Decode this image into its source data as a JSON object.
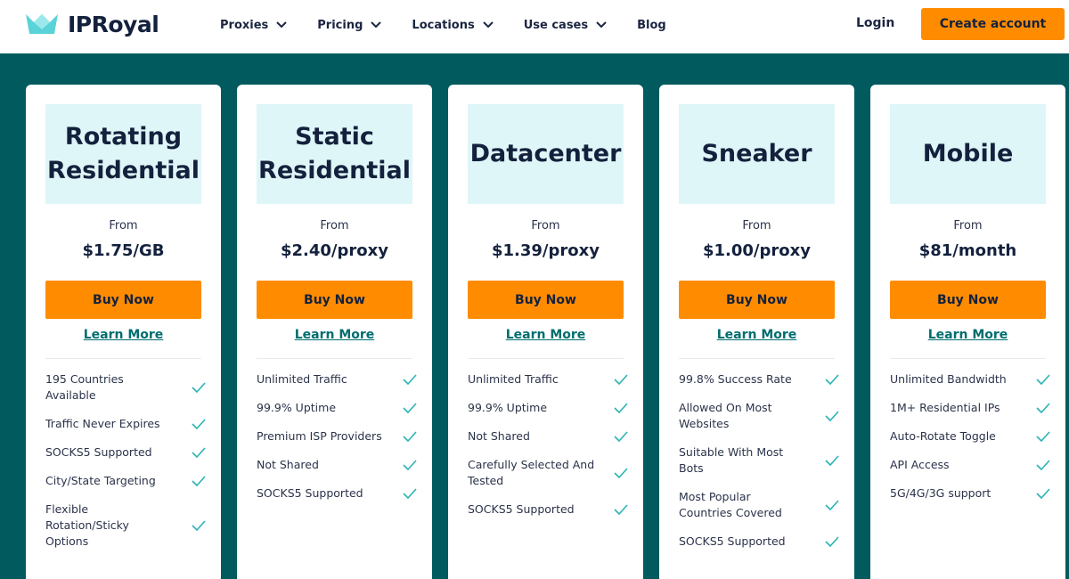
{
  "header": {
    "logo_text": "IPRoyal",
    "nav": [
      {
        "label": "Proxies",
        "dropdown": true
      },
      {
        "label": "Pricing",
        "dropdown": true
      },
      {
        "label": "Locations",
        "dropdown": true
      },
      {
        "label": "Use cases",
        "dropdown": true
      },
      {
        "label": "Blog",
        "dropdown": false
      }
    ],
    "login_label": "Login",
    "create_account_label": "Create account"
  },
  "colors": {
    "brand_teal": "#005a5e",
    "accent_orange": "#ff8c00",
    "title_bg": "#dff6f8",
    "check_teal": "#2bb3b5"
  },
  "cards": [
    {
      "title": "Rotating\nResidential",
      "from": "From",
      "price": "$1.75/GB",
      "buy_label": "Buy Now",
      "learn_label": "Learn More",
      "features": [
        "195 Countries\nAvailable",
        "Traffic Never Expires",
        "SOCKS5 Supported",
        "City/State Targeting",
        "Flexible\nRotation/Sticky\nOptions"
      ]
    },
    {
      "title": "Static\nResidential",
      "from": "From",
      "price": "$2.40/proxy",
      "buy_label": "Buy Now",
      "learn_label": "Learn More",
      "features": [
        "Unlimited Traffic",
        "99.9% Uptime",
        "Premium ISP Providers",
        "Not Shared",
        "SOCKS5 Supported"
      ]
    },
    {
      "title": "Datacenter",
      "from": "From",
      "price": "$1.39/proxy",
      "buy_label": "Buy Now",
      "learn_label": "Learn More",
      "features": [
        "Unlimited Traffic",
        "99.9% Uptime",
        "Not Shared",
        "Carefully Selected And\nTested",
        "SOCKS5 Supported"
      ]
    },
    {
      "title": "Sneaker",
      "from": "From",
      "price": "$1.00/proxy",
      "buy_label": "Buy Now",
      "learn_label": "Learn More",
      "features": [
        "99.8% Success Rate",
        "Allowed On Most\nWebsites",
        "Suitable With Most\nBots",
        "Most Popular\nCountries Covered",
        "SOCKS5 Supported"
      ]
    },
    {
      "title": "Mobile",
      "from": "From",
      "price": "$81/month",
      "buy_label": "Buy Now",
      "learn_label": "Learn More",
      "features": [
        "Unlimited Bandwidth",
        "1M+ Residential IPs",
        "Auto-Rotate Toggle",
        "API Access",
        "5G/4G/3G support"
      ]
    }
  ]
}
